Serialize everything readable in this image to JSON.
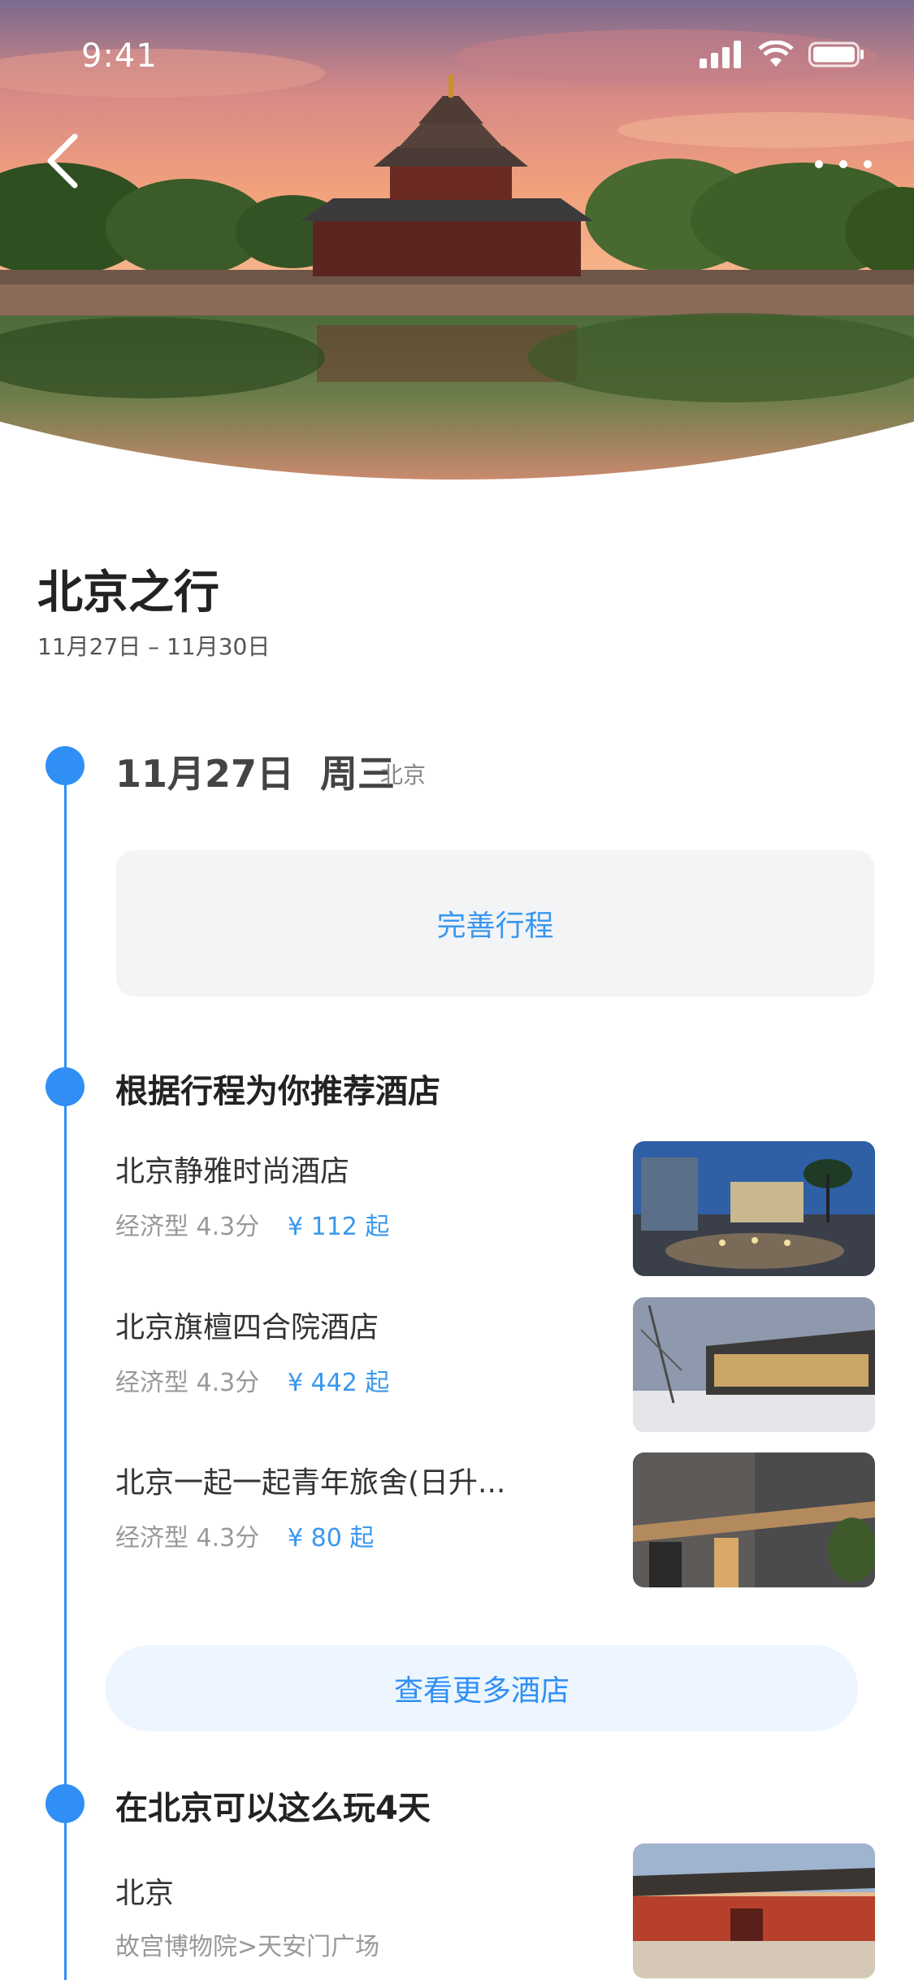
{
  "status_bar": {
    "time": "9:41"
  },
  "nav": {
    "back_icon": "chevron-left-icon",
    "more_icon": "more-horizontal-icon"
  },
  "trip": {
    "title": "北京之行",
    "dates": "11月27日 – 11月30日"
  },
  "day": {
    "date": "11月27日  周三",
    "city": "北京"
  },
  "complete_plan": {
    "label": "完善行程"
  },
  "hotels_section": {
    "title": "根据行程为你推荐酒店",
    "items": [
      {
        "name": "北京静雅时尚酒店",
        "meta": "经济型 4.3分",
        "price": "¥ 112 起"
      },
      {
        "name": "北京旗檀四合院酒店",
        "meta": "经济型 4.3分",
        "price": "¥ 442 起"
      },
      {
        "name": "北京一起一起青年旅舍(日升...",
        "meta": "经济型 4.3分",
        "price": "¥ 80 起"
      }
    ],
    "more_label": "查看更多酒店"
  },
  "play_section": {
    "title": "在北京可以这么玩4天",
    "city": "北京",
    "route": "故宫博物院>天安门广场"
  },
  "colors": {
    "accent": "#2f8ff4",
    "price": "#3a97ef",
    "card_bg": "#f3f4f6",
    "more_bg": "#edf6fe"
  }
}
